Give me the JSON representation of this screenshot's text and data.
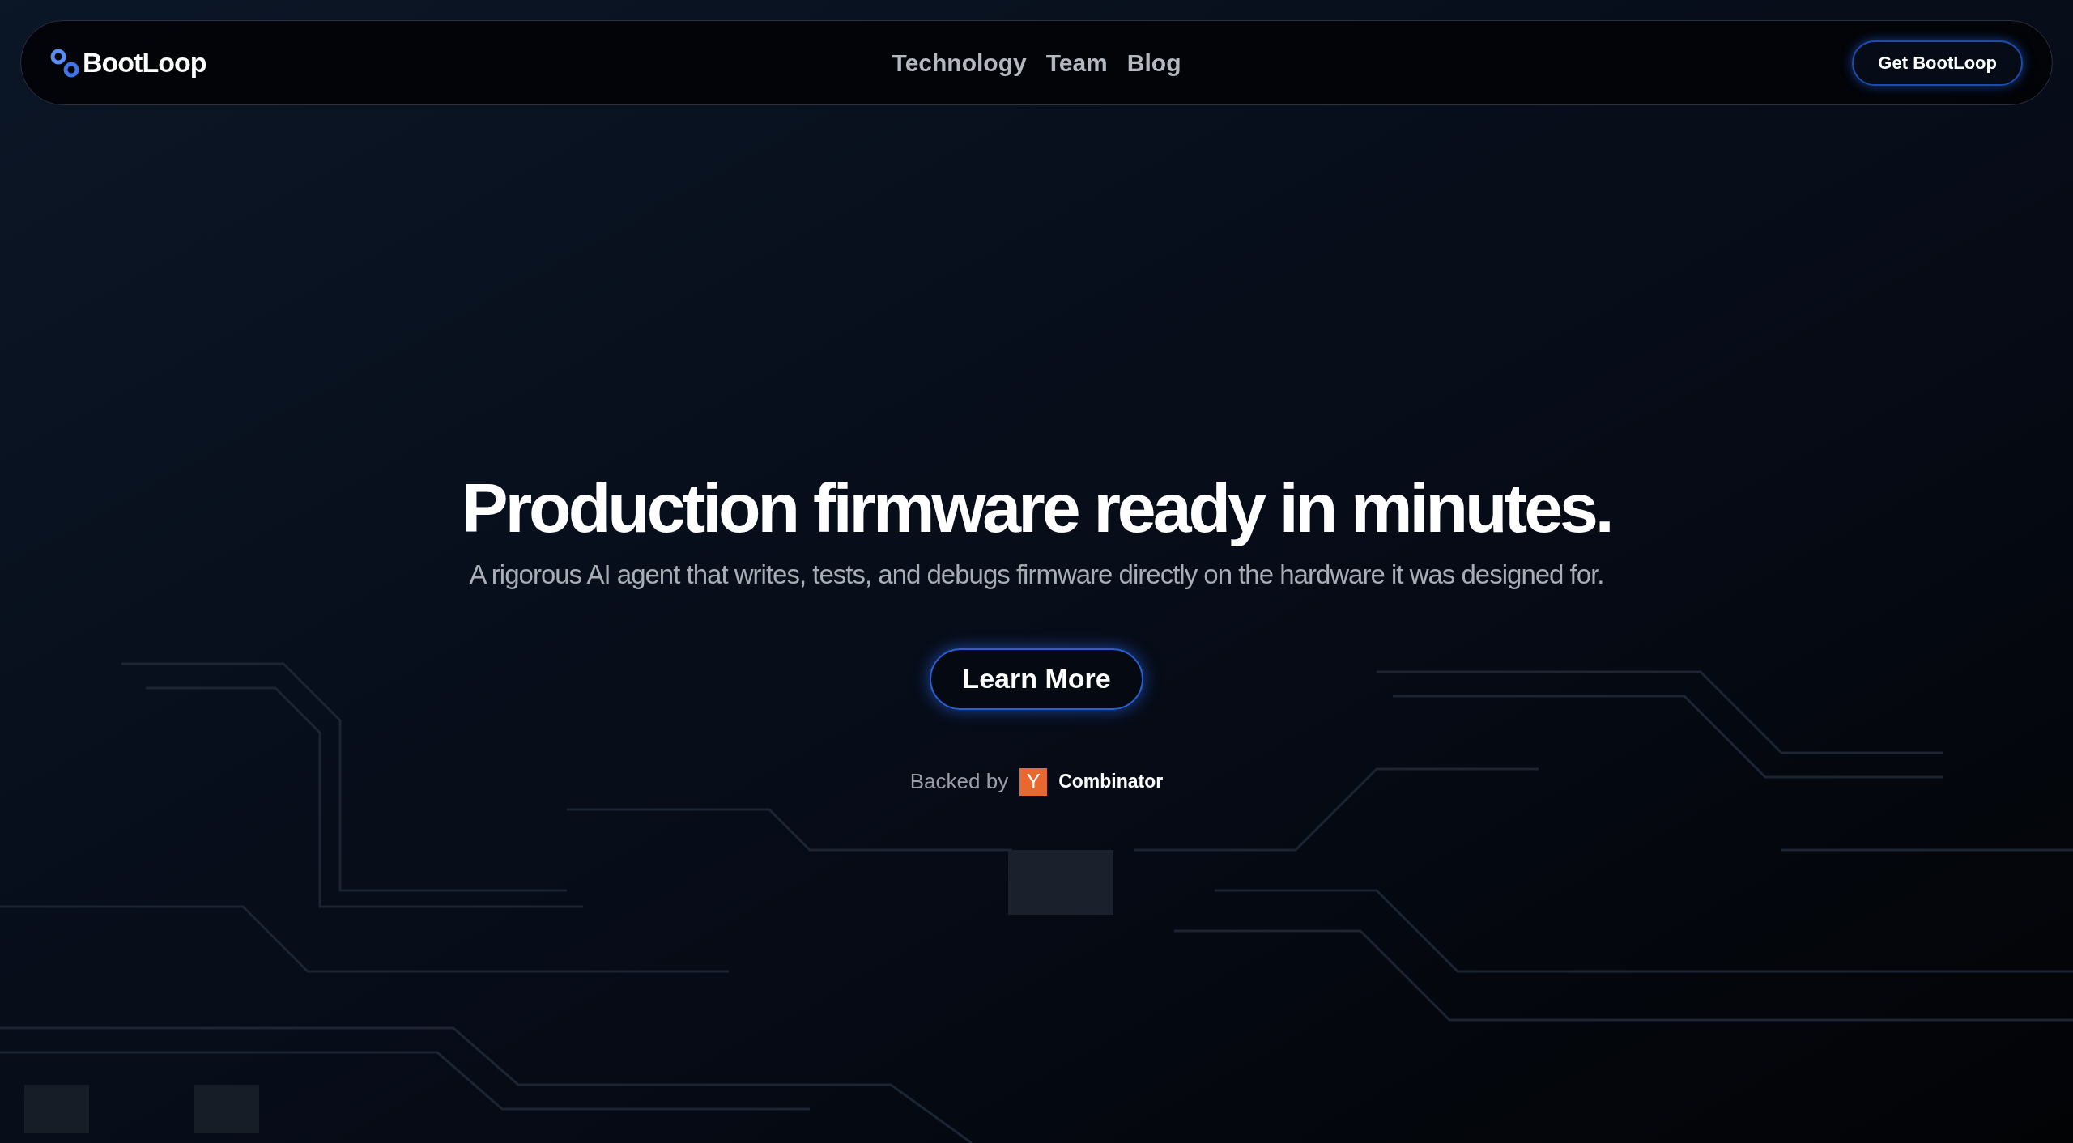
{
  "nav": {
    "logo": "BootLoop",
    "links": [
      {
        "label": "Technology"
      },
      {
        "label": "Team"
      },
      {
        "label": "Blog"
      }
    ],
    "cta": "Get BootLoop"
  },
  "hero": {
    "headline": "Production firmware ready in minutes.",
    "subtitle": "A rigorous AI agent that writes, tests, and debugs firmware directly on the hardware it was designed for.",
    "button": "Learn More",
    "backer": {
      "prefix": "Backed by",
      "mark": "Y",
      "name": "Combinator"
    }
  }
}
